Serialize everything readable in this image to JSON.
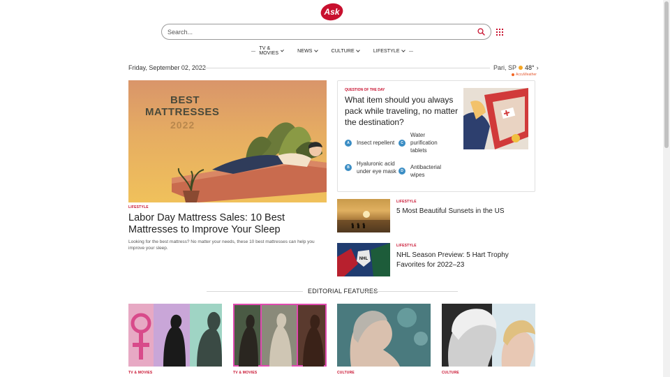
{
  "header": {
    "logo_text": "Ask",
    "search_placeholder": "Search..."
  },
  "nav": {
    "items": [
      "TV & MOVIES",
      "NEWS",
      "CULTURE",
      "LIFESTYLE"
    ]
  },
  "date_bar": {
    "date": "Friday, September 02, 2022",
    "location": "Pari, SP",
    "temperature": "48°",
    "provider": "AccuWeather"
  },
  "hero": {
    "image_text_1": "BEST",
    "image_text_2": "MATTRESSES",
    "image_text_3": "2022",
    "category": "LIFESTYLE",
    "title": "Labor Day Mattress Sales: 10 Best Mattresses to Improve Your Sleep",
    "summary": "Looking for the best mattress? No matter your needs, these 10 best mattresses can help you improve your sleep."
  },
  "question": {
    "label": "QUESTION OF THE DAY",
    "text": "What item should you always pack while traveling, no matter the destination?",
    "options": [
      {
        "letter": "A",
        "text": "Insect repellent"
      },
      {
        "letter": "B",
        "text": "Hyaluronic acid under eye mask"
      },
      {
        "letter": "C",
        "text": "Water purification tablets"
      },
      {
        "letter": "D",
        "text": "Antibacterial wipes"
      }
    ]
  },
  "side_articles": [
    {
      "category": "LIFESTYLE",
      "title": "5 Most Beautiful Sunsets in the US"
    },
    {
      "category": "LIFESTYLE",
      "title": "NHL Season Preview: 5 Hart Trophy Favorites for 2022–23"
    }
  ],
  "editorial": {
    "heading": "EDITORIAL FEATURES",
    "cards": [
      {
        "category": "TV & MOVIES"
      },
      {
        "category": "TV & MOVIES"
      },
      {
        "category": "CULTURE"
      },
      {
        "category": "CULTURE"
      }
    ]
  },
  "colors": {
    "brand_red": "#c8102e",
    "option_blue": "#3a8dc4"
  }
}
